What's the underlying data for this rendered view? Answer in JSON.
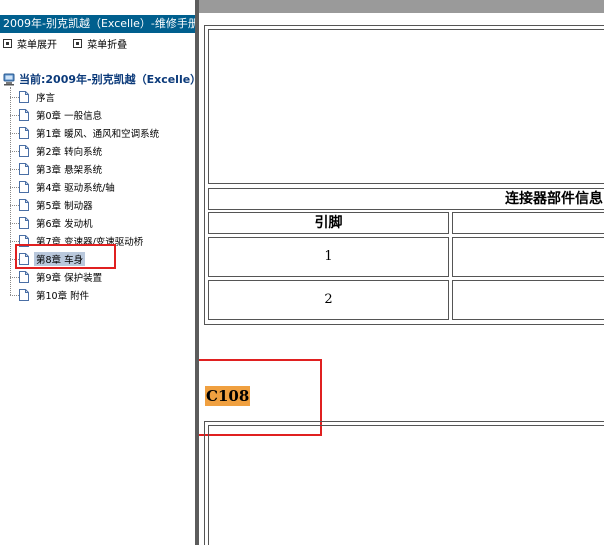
{
  "left_pane": {
    "title": "2009年-别克凯越（Excelle）-维修手册",
    "menu": {
      "expand_label": "菜单展开",
      "collapse_label": "菜单折叠"
    },
    "tree": {
      "root_label": "当前:2009年-别克凯越（Excelle）",
      "items": [
        {
          "label": "序言"
        },
        {
          "label": "第0章 一般信息"
        },
        {
          "label": "第1章 暖风、通风和空调系统"
        },
        {
          "label": "第2章 转向系统"
        },
        {
          "label": "第3章 悬架系统"
        },
        {
          "label": "第4章 驱动系统/轴"
        },
        {
          "label": "第5章 制动器"
        },
        {
          "label": "第6章 发动机"
        },
        {
          "label": "第7章 变速器/变速驱动桥"
        },
        {
          "label": "第8章 车身",
          "selected": true
        },
        {
          "label": "第9章 保护装置"
        },
        {
          "label": "第10章 附件"
        }
      ]
    }
  },
  "content": {
    "connector_header": "连接器部件信息",
    "pin_column_header": "引脚",
    "pins": [
      "1",
      "2"
    ],
    "connector_id": "C108"
  },
  "colors": {
    "title_bar": "#005f8e",
    "selected_item": "#b9c8dc",
    "highlight": "#f0a040",
    "annotation_box": "#e02020"
  }
}
